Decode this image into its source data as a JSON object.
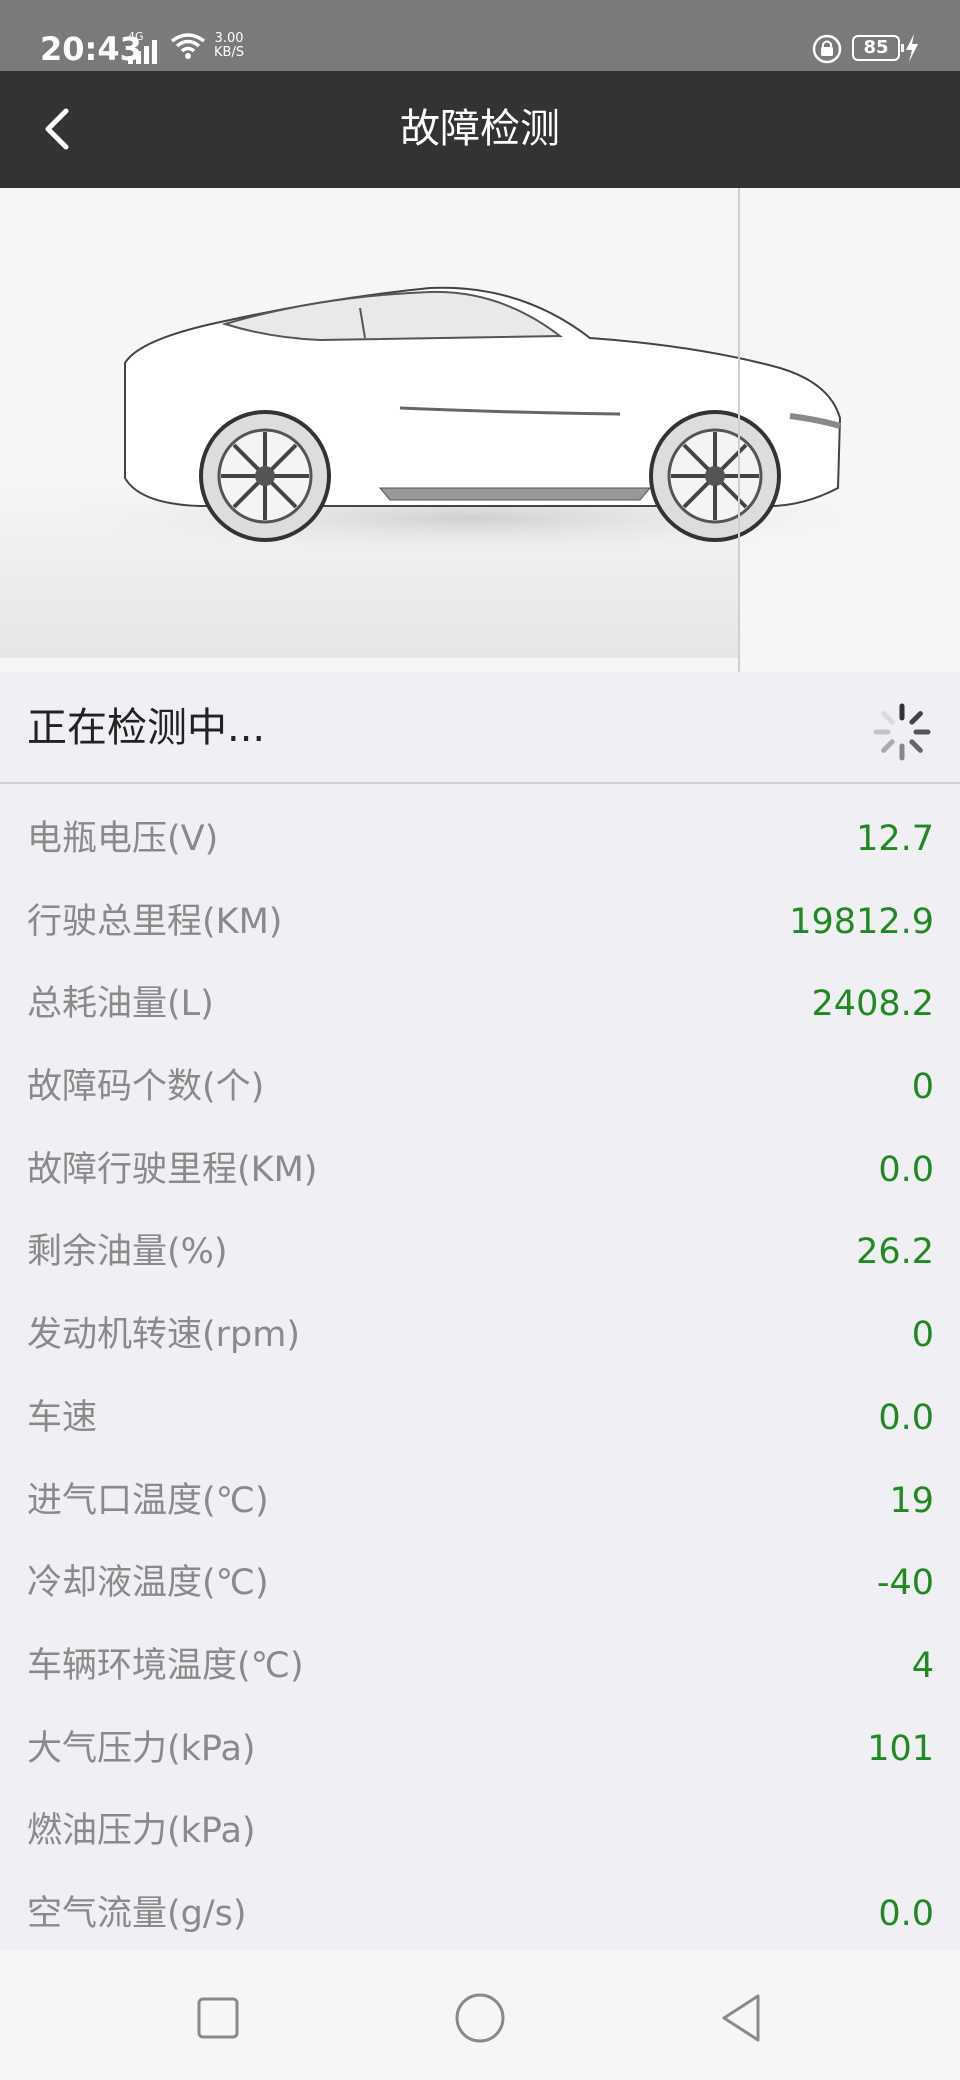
{
  "status_bar": {
    "time": "20:43",
    "network": "4G",
    "speed_value": "3.00",
    "speed_unit": "KB/S",
    "battery": "85",
    "icons": [
      "signal-icon",
      "wifi-icon",
      "lock-icon",
      "battery-icon",
      "charging-icon"
    ]
  },
  "header": {
    "title": "故障检测",
    "back_icon": "chevron-left-icon"
  },
  "hero": {
    "image": "sports-car-sketch"
  },
  "detection": {
    "status_text": "正在检测中...",
    "spinner_icon": "loading-spinner-icon"
  },
  "metrics": [
    {
      "label": "电瓶电压(V)",
      "value": "12.7"
    },
    {
      "label": "行驶总里程(KM)",
      "value": "19812.9"
    },
    {
      "label": "总耗油量(L)",
      "value": "2408.2"
    },
    {
      "label": "故障码个数(个)",
      "value": "0"
    },
    {
      "label": "故障行驶里程(KM)",
      "value": "0.0"
    },
    {
      "label": "剩余油量(%)",
      "value": "26.2"
    },
    {
      "label": "发动机转速(rpm)",
      "value": "0"
    },
    {
      "label": "车速",
      "value": "0.0"
    },
    {
      "label": "进气口温度(℃)",
      "value": "19"
    },
    {
      "label": "冷却液温度(℃)",
      "value": "-40"
    },
    {
      "label": "车辆环境温度(℃)",
      "value": "4"
    },
    {
      "label": "大气压力(kPa)",
      "value": "101"
    },
    {
      "label": "燃油压力(kPa)",
      "value": ""
    },
    {
      "label": "空气流量(g/s)",
      "value": "0.0"
    }
  ],
  "colors": {
    "header_bg": "#333333",
    "value_green": "#1f8a1f",
    "label_gray": "#8a8a8a",
    "page_bg": "#efeff4"
  },
  "nav_bar": {
    "icons": [
      "recent-apps-icon",
      "home-icon",
      "back-triangle-icon"
    ]
  }
}
